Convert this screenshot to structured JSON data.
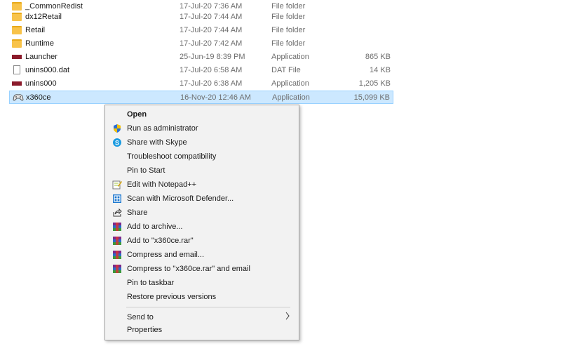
{
  "files": [
    {
      "name": "_CommonRedist",
      "date": "17-Jul-20 7:36 AM",
      "type": "File folder",
      "size": "",
      "icon": "folder-icon"
    },
    {
      "name": "dx12Retail",
      "date": "17-Jul-20 7:44 AM",
      "type": "File folder",
      "size": "",
      "icon": "folder-icon"
    },
    {
      "name": "Retail",
      "date": "17-Jul-20 7:44 AM",
      "type": "File folder",
      "size": "",
      "icon": "folder-icon"
    },
    {
      "name": "Runtime",
      "date": "17-Jul-20 7:42 AM",
      "type": "File folder",
      "size": "",
      "icon": "folder-icon"
    },
    {
      "name": "Launcher",
      "date": "25-Jun-19 8:39 PM",
      "type": "Application",
      "size": "865 KB",
      "icon": "application-icon"
    },
    {
      "name": "unins000.dat",
      "date": "17-Jul-20 6:58 AM",
      "type": "DAT File",
      "size": "14 KB",
      "icon": "dat-file-icon"
    },
    {
      "name": "unins000",
      "date": "17-Jul-20 6:38 AM",
      "type": "Application",
      "size": "1,205 KB",
      "icon": "application-icon"
    },
    {
      "name": "x360ce",
      "date": "16-Nov-20 12:46 AM",
      "type": "Application",
      "size": "15,099 KB",
      "icon": "gamepad-icon"
    }
  ],
  "context_menu": {
    "items": [
      {
        "label": "Open",
        "icon": ""
      },
      {
        "label": "Run as administrator",
        "icon": "uac-shield-icon"
      },
      {
        "label": "Share with Skype",
        "icon": "skype-icon"
      },
      {
        "label": "Troubleshoot compatibility",
        "icon": ""
      },
      {
        "label": "Pin to Start",
        "icon": ""
      },
      {
        "label": "Edit with Notepad++",
        "icon": "notepad-plus-plus-icon"
      },
      {
        "label": "Scan with Microsoft Defender...",
        "icon": "defender-icon"
      },
      {
        "label": "Share",
        "icon": "share-icon"
      },
      {
        "label": "Add to archive...",
        "icon": "winrar-icon"
      },
      {
        "label": "Add to \"x360ce.rar\"",
        "icon": "winrar-icon"
      },
      {
        "label": "Compress and email...",
        "icon": "winrar-icon"
      },
      {
        "label": "Compress to \"x360ce.rar\" and email",
        "icon": "winrar-icon"
      },
      {
        "label": "Pin to taskbar",
        "icon": ""
      },
      {
        "label": "Restore previous versions",
        "icon": ""
      },
      {
        "label": "Send to",
        "icon": "chevron-right-icon"
      },
      {
        "label": "Properties",
        "icon": ""
      }
    ]
  },
  "colors": {
    "selection_bg": "#cce8ff",
    "selection_border": "#99d1ff",
    "menu_bg": "#f2f2f2",
    "folder": "#f8c34a",
    "application": "#8b1a2b"
  }
}
